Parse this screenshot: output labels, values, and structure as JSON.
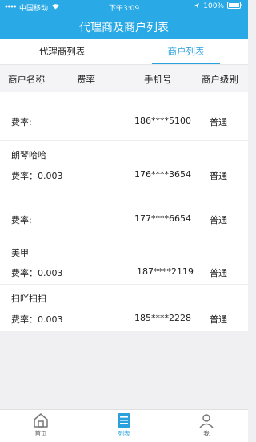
{
  "status": {
    "carrier": "中国移动",
    "time": "下午3:09",
    "battery": "100%"
  },
  "header": {
    "title": "代理商及商户列表"
  },
  "tabs": [
    {
      "label": "代理商列表"
    },
    {
      "label": "商户列表"
    }
  ],
  "columns": {
    "name": "商户名称",
    "rate": "费率",
    "phone": "手机号",
    "level": "商户级别"
  },
  "merchants": [
    {
      "name": "",
      "rate": "费率:",
      "phone": "186****5100",
      "level": "普通"
    },
    {
      "name": "朗琴哈哈",
      "rate": "费率：0.003",
      "phone": "176****3654",
      "level": "普通"
    },
    {
      "name": "",
      "rate": "费率:",
      "phone": "177****6654",
      "level": "普通"
    },
    {
      "name": "美甲",
      "rate": "费率：0.003",
      "phone": "187****2119",
      "level": "普通"
    },
    {
      "name": "扫吖扫扫",
      "rate": "费率：0.003",
      "phone": "185****2228",
      "level": "普通"
    }
  ],
  "tabbar": [
    {
      "label": "首页"
    },
    {
      "label": "列表"
    },
    {
      "label": "我"
    }
  ],
  "colors": {
    "accent": "#29a9e6",
    "active": "#2aa0dd"
  },
  "icons": {
    "home": "home-icon",
    "list": "list-icon",
    "profile": "profile-icon"
  }
}
